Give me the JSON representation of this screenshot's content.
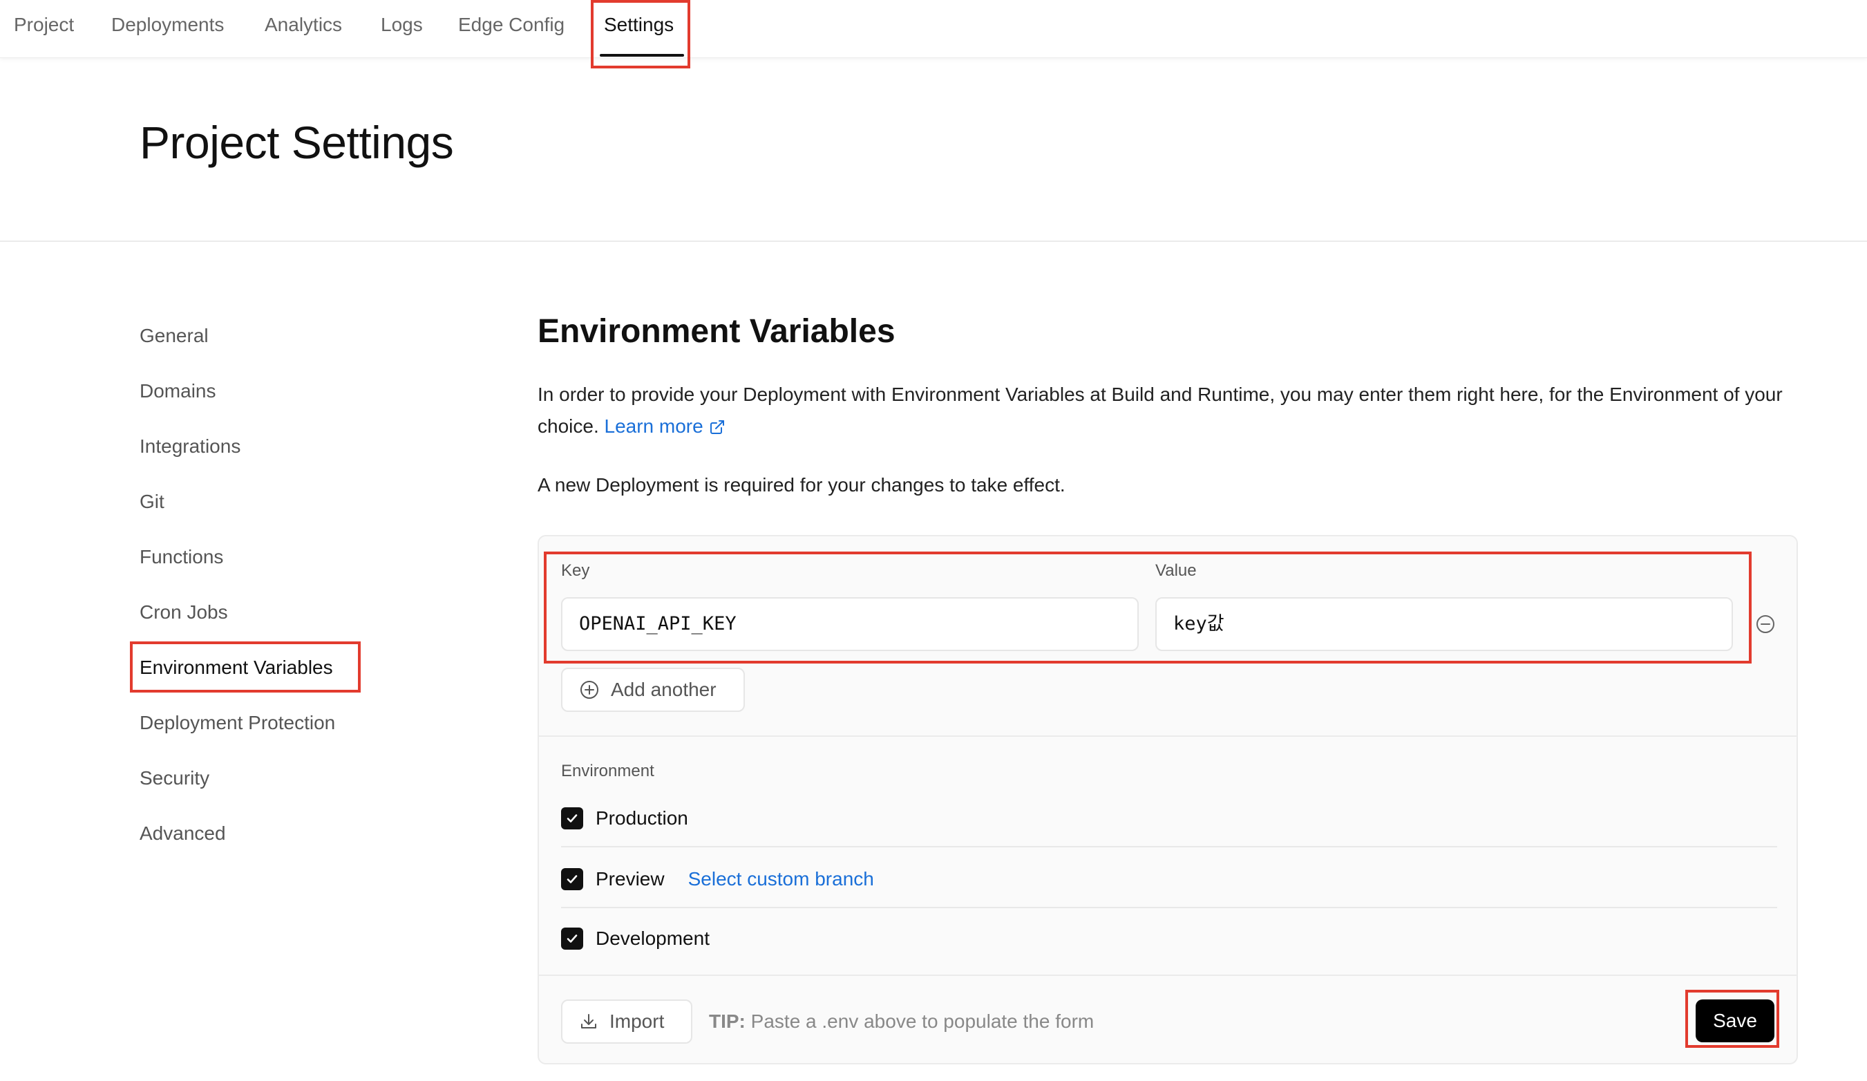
{
  "nav": {
    "tabs": [
      {
        "label": "Project"
      },
      {
        "label": "Deployments"
      },
      {
        "label": "Analytics"
      },
      {
        "label": "Logs"
      },
      {
        "label": "Edge Config"
      },
      {
        "label": "Settings",
        "active": true
      }
    ]
  },
  "header": {
    "title": "Project Settings"
  },
  "sidebar": {
    "items": [
      {
        "label": "General"
      },
      {
        "label": "Domains"
      },
      {
        "label": "Integrations"
      },
      {
        "label": "Git"
      },
      {
        "label": "Functions"
      },
      {
        "label": "Cron Jobs"
      },
      {
        "label": "Environment Variables",
        "active": true
      },
      {
        "label": "Deployment Protection"
      },
      {
        "label": "Security"
      },
      {
        "label": "Advanced"
      }
    ]
  },
  "main": {
    "title": "Environment Variables",
    "description": "In order to provide your Deployment with Environment Variables at Build and Runtime, you may enter them right here, for the Environment of your choice.",
    "learn_more": "Learn more",
    "note": "A new Deployment is required for your changes to take effect.",
    "form": {
      "key_label": "Key",
      "value_label": "Value",
      "key_value": "OPENAI_API_KEY",
      "value_value": "key값",
      "add_another": "Add another",
      "environment_label": "Environment",
      "environments": [
        {
          "label": "Production",
          "checked": true
        },
        {
          "label": "Preview",
          "checked": true,
          "link": "Select custom branch"
        },
        {
          "label": "Development",
          "checked": true
        }
      ],
      "import_label": "Import",
      "tip_prefix": "TIP:",
      "tip_text": "Paste a .env above to populate the form",
      "save_label": "Save"
    }
  },
  "colors": {
    "highlight": "#e23b2e",
    "link": "#1a6fd8",
    "primary_button": "#000000"
  },
  "icons": {
    "external_link": "external-link-icon",
    "add": "plus-circle-icon",
    "remove": "minus-circle-icon",
    "checkbox": "check-icon",
    "import": "download-icon"
  }
}
